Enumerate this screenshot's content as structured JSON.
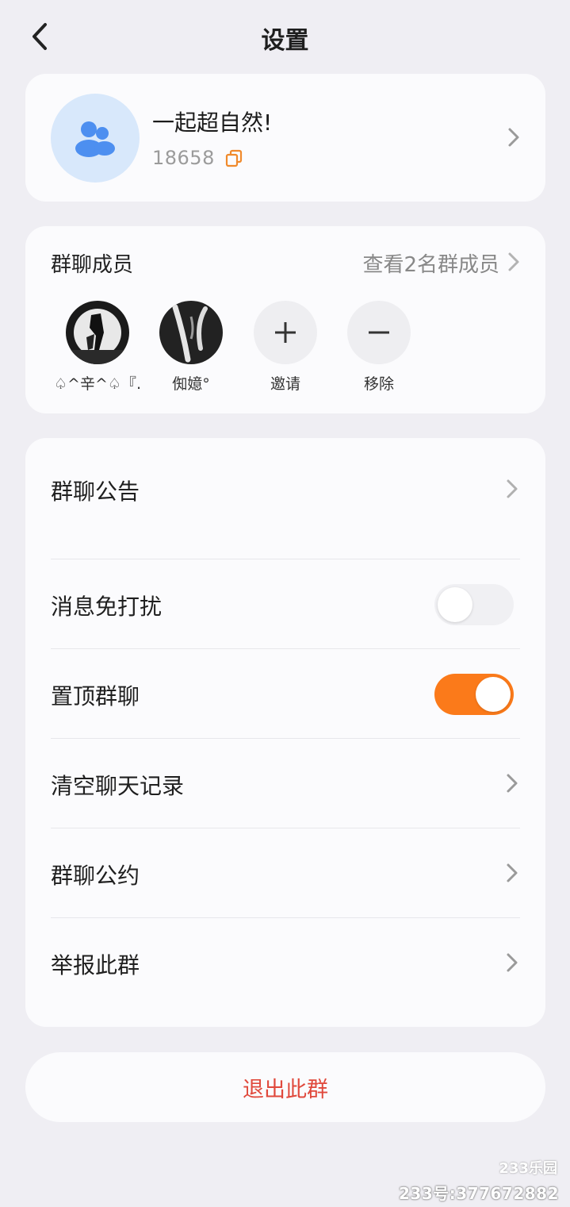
{
  "header": {
    "title": "设置"
  },
  "group": {
    "name": "一起超自然!",
    "id": "18658"
  },
  "members": {
    "title": "群聊成员",
    "view_all": "查看2名群成员",
    "list": [
      {
        "name": "♤^辛^♤『…"
      },
      {
        "name": "倁嬑°"
      }
    ],
    "invite_label": "邀请",
    "remove_label": "移除"
  },
  "settings": {
    "announcement": "群聊公告",
    "mute": {
      "label": "消息免打扰",
      "enabled": false
    },
    "pin": {
      "label": "置顶群聊",
      "enabled": true
    },
    "clear_history": "清空聊天记录",
    "group_rules": "群聊公约",
    "report": "举报此群"
  },
  "exit_label": "退出此群",
  "watermark": {
    "logo": "233乐园",
    "text": "233号:377672882"
  },
  "colors": {
    "accent": "#fb7a1a",
    "danger": "#e0493c",
    "avatar_bg": "#d8e8fb",
    "avatar_icon": "#4d8ff0"
  },
  "icons": [
    "back-arrow-icon",
    "group-people-icon",
    "copy-icon",
    "chevron-right-icon",
    "plus-icon",
    "minus-icon"
  ]
}
